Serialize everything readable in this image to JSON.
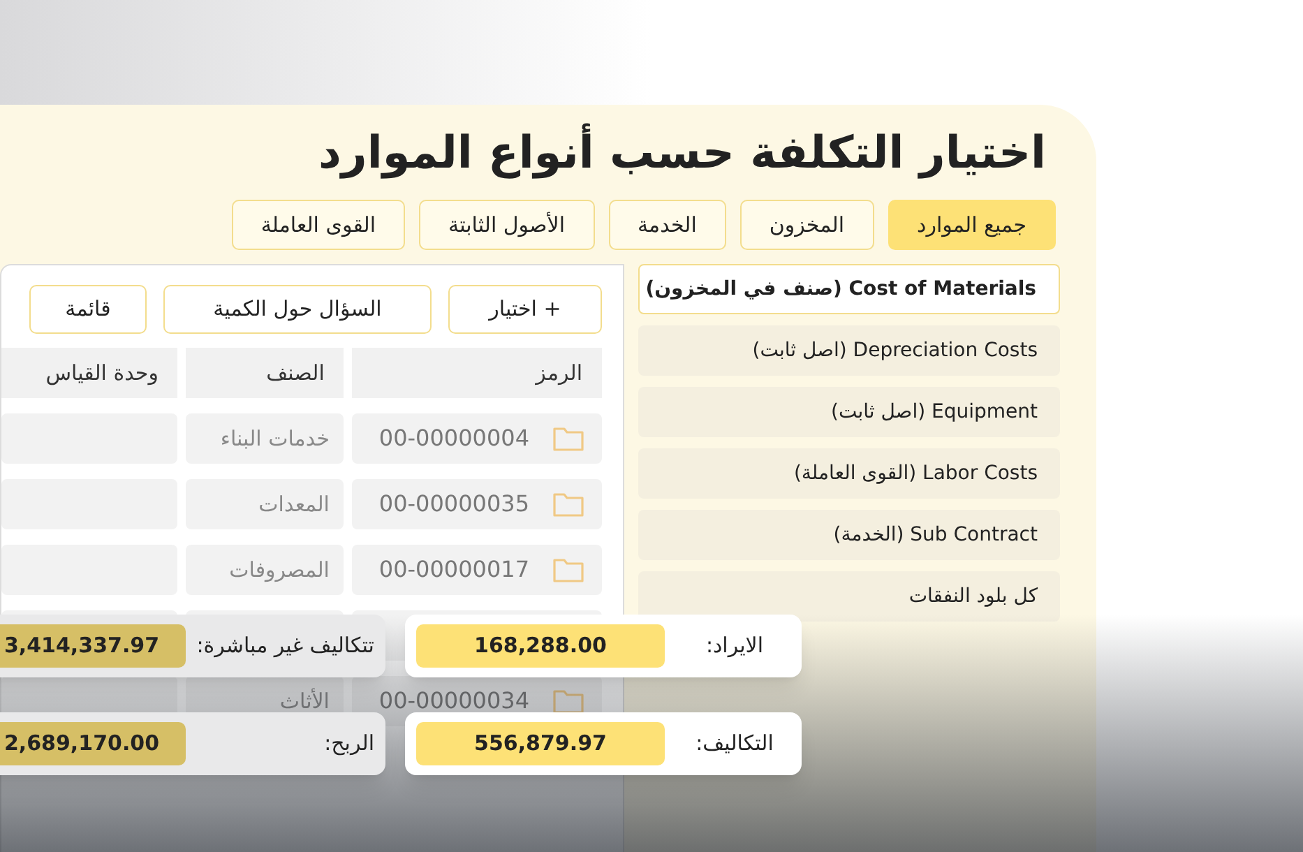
{
  "title": "اختيار التكلفة حسب أنواع الموارد",
  "tabs": [
    {
      "label": "جميع الموارد",
      "selected": true
    },
    {
      "label": "المخزون",
      "selected": false
    },
    {
      "label": "الخدمة",
      "selected": false
    },
    {
      "label": "الأصول الثابتة",
      "selected": false
    },
    {
      "label": "القوى العاملة",
      "selected": false
    }
  ],
  "cost_items": [
    {
      "label": "Cost of Materials (صنف في المخزون)",
      "selected": true
    },
    {
      "label": "Depreciation Costs (اصل ثابت)",
      "selected": false
    },
    {
      "label": "Equipment (اصل ثابت)",
      "selected": false
    },
    {
      "label": "Labor Costs (القوى العاملة)",
      "selected": false
    },
    {
      "label": "Sub Contract (الخدمة)",
      "selected": false
    },
    {
      "label": "كل بلود النفقات",
      "selected": false
    }
  ],
  "toolbar": [
    "+ اختيار",
    "السؤال حول الكمية",
    "قائمة"
  ],
  "table": {
    "columns": [
      "الرمز",
      "الصنف",
      "وحدة القياس"
    ],
    "rows": [
      {
        "code": "00-00000004",
        "category": "خدمات البناء"
      },
      {
        "code": "00-00000035",
        "category": "المعدات"
      },
      {
        "code": "00-00000017",
        "category": "المصروفات"
      },
      {
        "code": "",
        "category": ""
      },
      {
        "code": "00-00000034",
        "category": "الأثاث"
      }
    ]
  },
  "summary": [
    {
      "label": "الايراد:",
      "value": "168,288.00"
    },
    {
      "label": "تتكاليف غير مباشرة:",
      "value": "3,414,337.97"
    },
    {
      "label": "التكاليف:",
      "value": "556,879.97"
    },
    {
      "label": "الربح:",
      "value": "2,689,170.00"
    }
  ]
}
